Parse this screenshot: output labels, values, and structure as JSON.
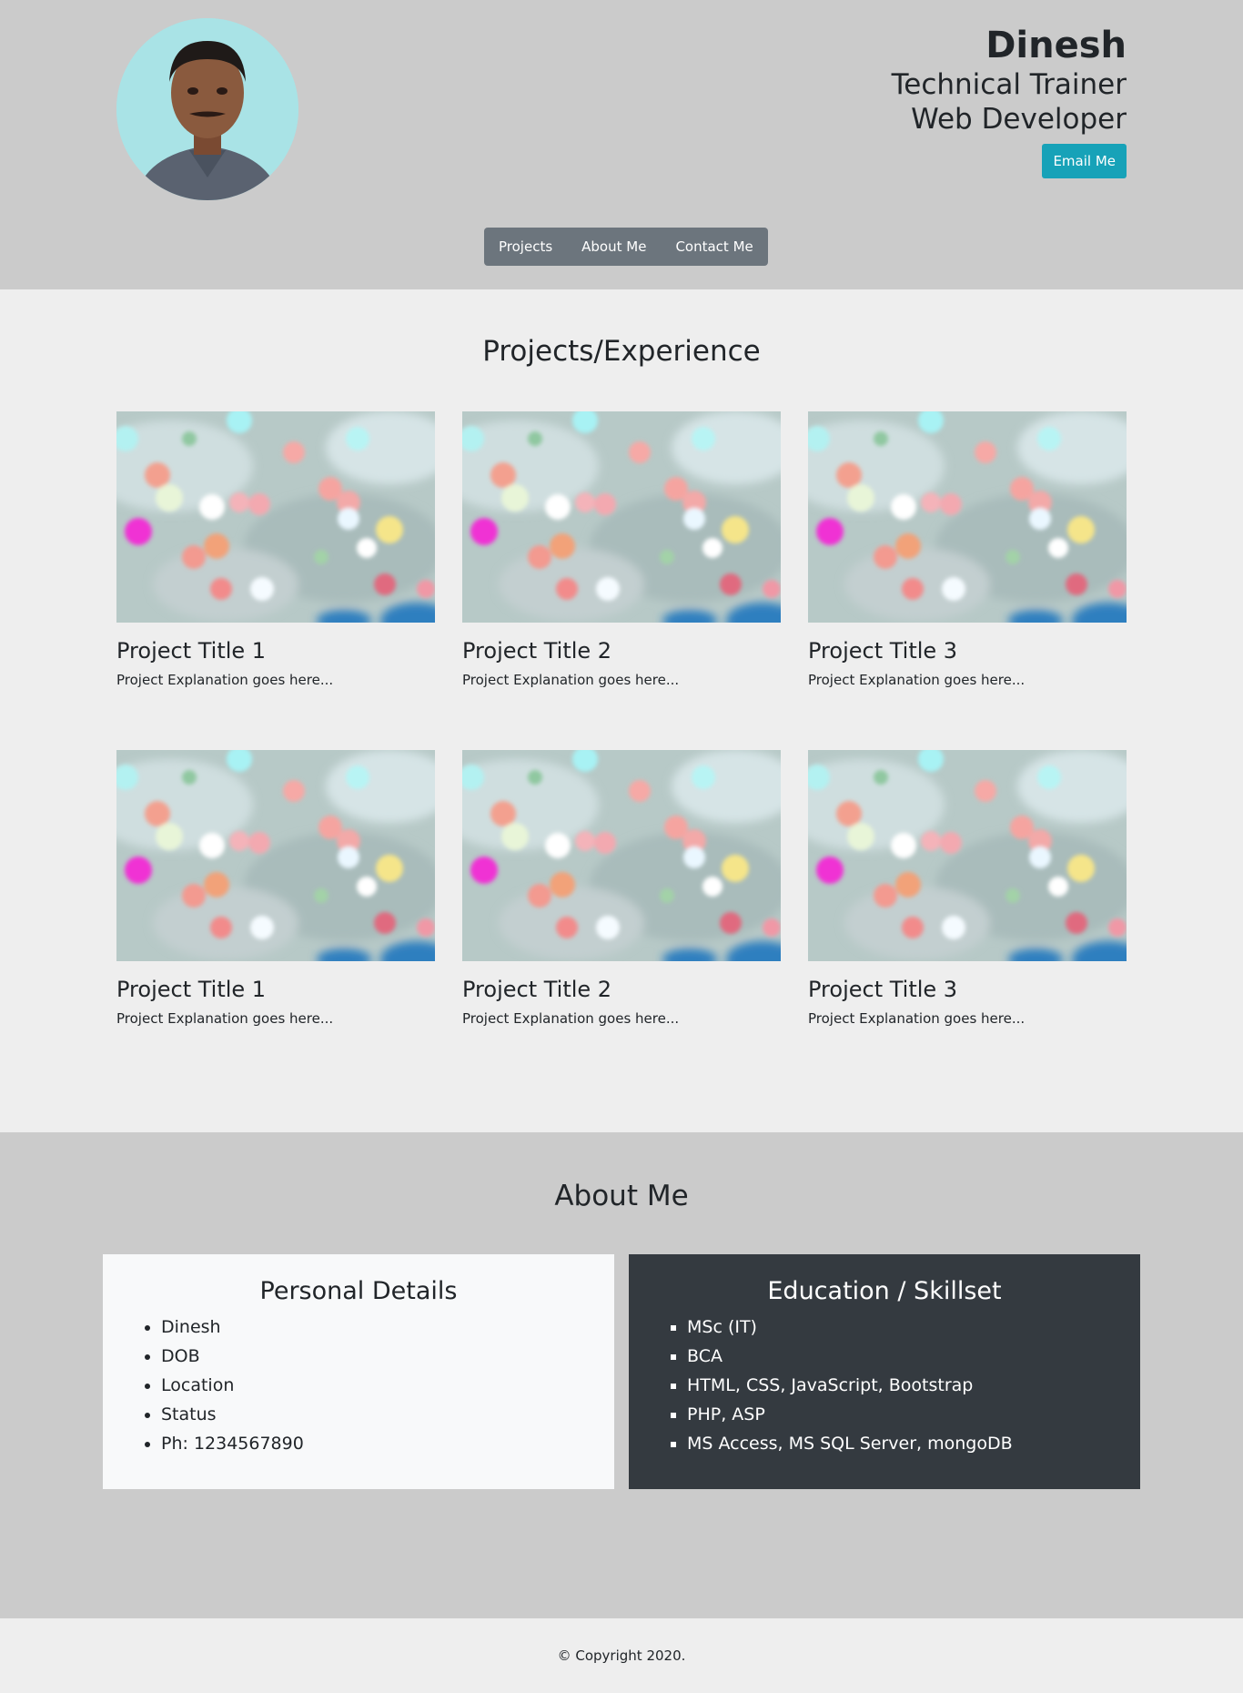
{
  "header": {
    "name": "Dinesh",
    "role_line1": "Technical Trainer",
    "role_line2": "Web Developer",
    "email_button": "Email Me",
    "avatar_icon": "profile-photo"
  },
  "nav": {
    "items": [
      "Projects",
      "About Me",
      "Contact Me"
    ]
  },
  "projects": {
    "title": "Projects/Experience",
    "cards": [
      {
        "title": "Project Title 1",
        "text": "Project Explanation goes here..."
      },
      {
        "title": "Project Title 2",
        "text": "Project Explanation goes here..."
      },
      {
        "title": "Project Title 3",
        "text": "Project Explanation goes here..."
      },
      {
        "title": "Project Title 1",
        "text": "Project Explanation goes here..."
      },
      {
        "title": "Project Title 2",
        "text": "Project Explanation goes here..."
      },
      {
        "title": "Project Title 3",
        "text": "Project Explanation goes here..."
      }
    ]
  },
  "about": {
    "title": "About Me",
    "personal": {
      "title": "Personal Details",
      "items": [
        "Dinesh",
        "DOB",
        "Location",
        "Status",
        "Ph: 1234567890"
      ]
    },
    "education": {
      "title": "Education / Skillset",
      "items": [
        "MSc (IT)",
        "BCA",
        "HTML, CSS, JavaScript, Bootstrap",
        "PHP, ASP",
        "MS Access, MS SQL Server, mongoDB"
      ]
    }
  },
  "footer": {
    "copyright": "© Copyright 2020."
  },
  "colors": {
    "header_bg": "#cbcbcb",
    "section_bg": "#eeeeee",
    "email_button": "#17a2b8",
    "nav_bg": "#6c757d",
    "panel_dark": "#343a40",
    "panel_light": "#f8f9fa"
  }
}
